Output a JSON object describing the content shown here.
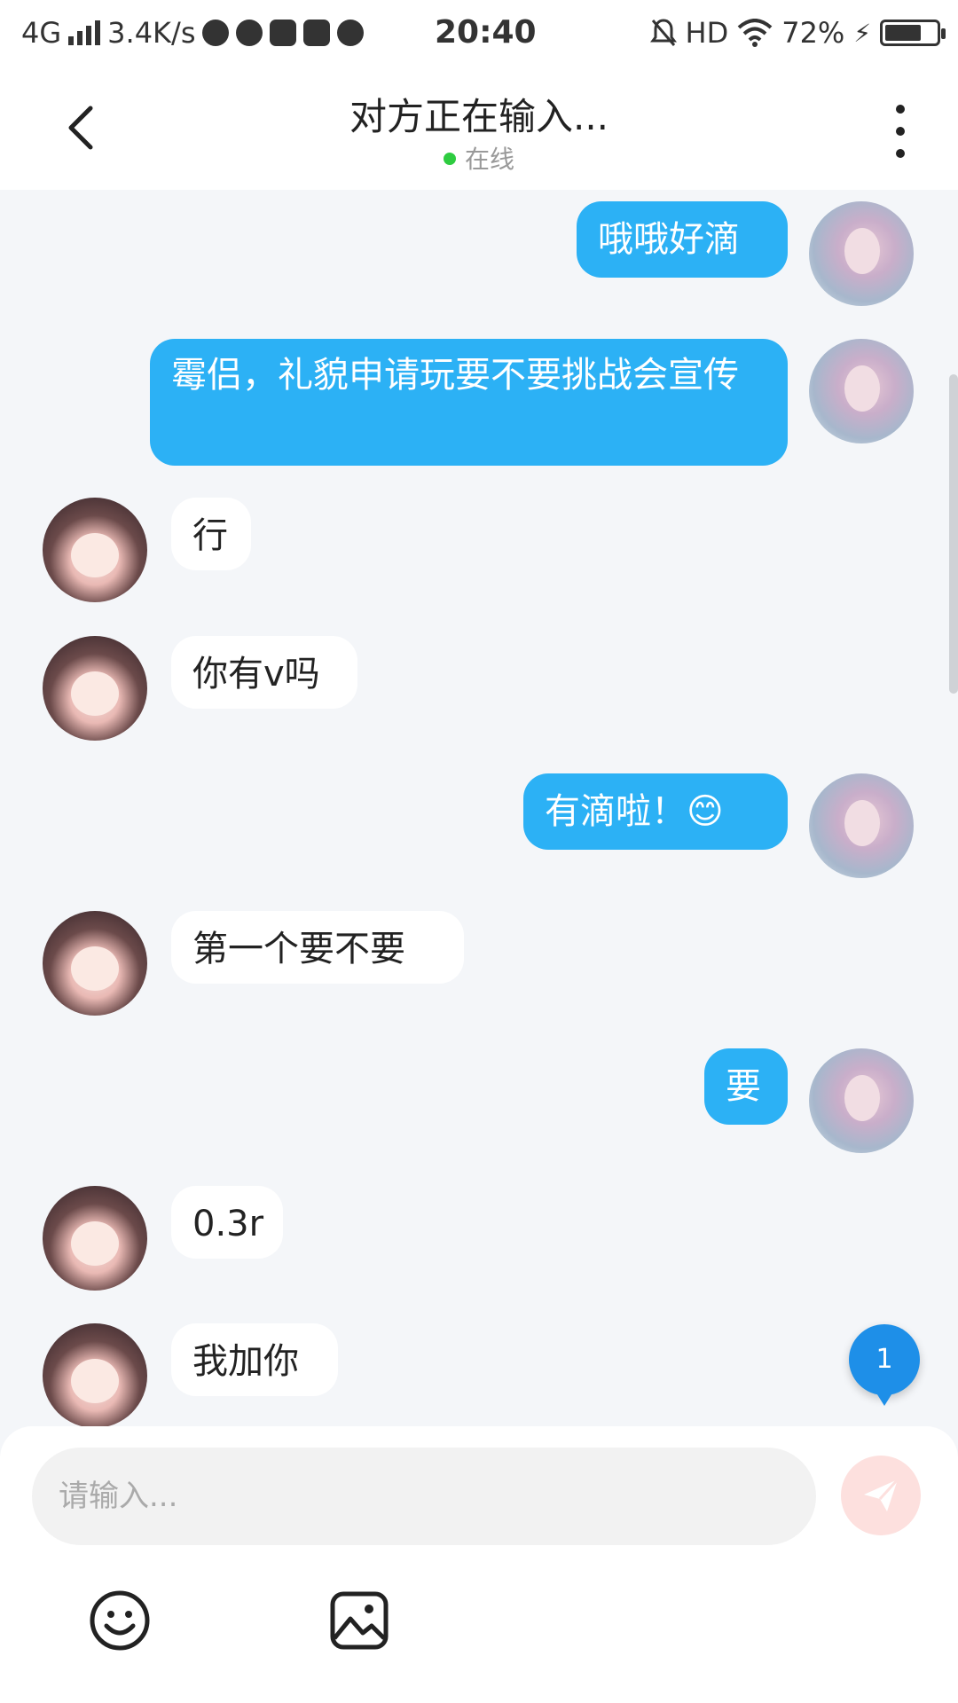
{
  "status_bar": {
    "network": "4G",
    "speed": "3.4K/s",
    "time": "20:40",
    "hd": "HD",
    "battery": "72%",
    "battery_level": 0.72
  },
  "header": {
    "title": "对方正在输入...",
    "subtitle": "在线"
  },
  "messages": [
    {
      "side": "me",
      "text": "哦哦好滴"
    },
    {
      "side": "me",
      "text": "霉侣，礼貌申请玩要不要挑战会宣传"
    },
    {
      "side": "other",
      "text": "行"
    },
    {
      "side": "other",
      "text": "你有v吗"
    },
    {
      "side": "me",
      "text": "有滴啦！😊"
    },
    {
      "side": "other",
      "text": "第一个要不要"
    },
    {
      "side": "me",
      "text": "要"
    },
    {
      "side": "other",
      "text": "0.3r"
    },
    {
      "side": "other",
      "text": "我加你"
    }
  ],
  "unread_count": "1",
  "input": {
    "placeholder": "请输入..."
  },
  "colors": {
    "my_bubble": "#2cb1f5",
    "other_bubble": "#ffffff",
    "online": "#2ecc40",
    "send_button": "#fde0de",
    "badge": "#1e8fe8"
  }
}
